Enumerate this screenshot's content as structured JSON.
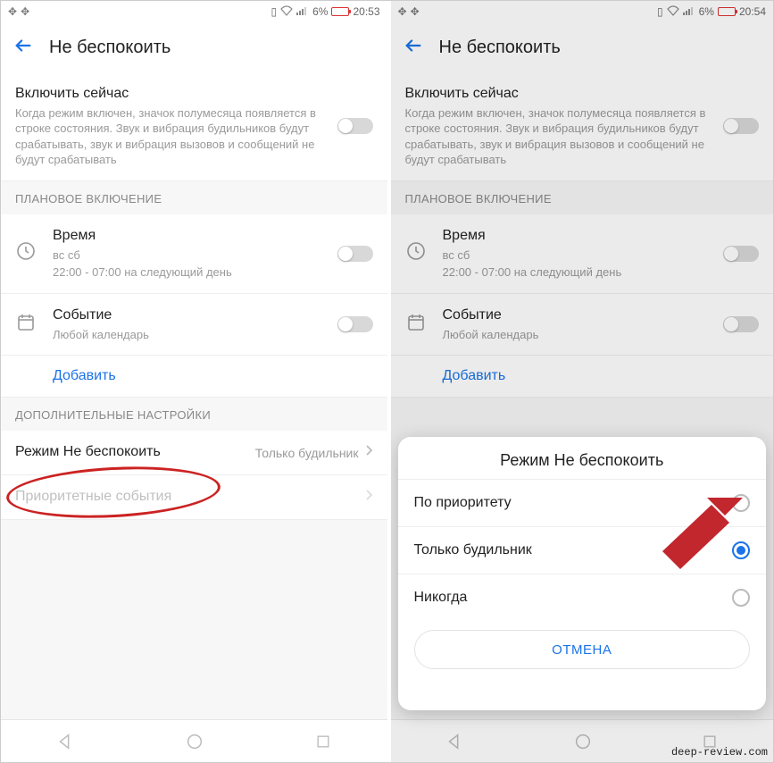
{
  "left": {
    "status": {
      "battery_pct": "6%",
      "time": "20:53"
    },
    "header": {
      "title": "Не беспокоить"
    },
    "enable_now": {
      "title": "Включить сейчас",
      "desc": "Когда режим включен, значок полумесяца появляется в строке состояния. Звук и вибрация будильников будут срабатывать, звук и вибрация вызовов и сообщений не будут срабатывать"
    },
    "sections": {
      "scheduled_header": "ПЛАНОВОЕ ВКЛЮЧЕНИЕ",
      "time_row": {
        "title": "Время",
        "sub1": "вс сб",
        "sub2": "22:00 - 07:00 на следующий день"
      },
      "event_row": {
        "title": "Событие",
        "sub": "Любой календарь"
      },
      "add": "Добавить",
      "extra_header": "ДОПОЛНИТЕЛЬНЫЕ НАСТРОЙКИ",
      "mode_row": {
        "title": "Режим Не беспокоить",
        "value": "Только будильник"
      },
      "priority_row": {
        "title": "Приоритетные события"
      }
    }
  },
  "right": {
    "status": {
      "battery_pct": "6%",
      "time": "20:54"
    },
    "header": {
      "title": "Не беспокоить"
    },
    "enable_now": {
      "title": "Включить сейчас",
      "desc": "Когда режим включен, значок полумесяца появляется в строке состояния. Звук и вибрация будильников будут срабатывать, звук и вибрация вызовов и сообщений не будут срабатывать"
    },
    "sections": {
      "scheduled_header": "ПЛАНОВОЕ ВКЛЮЧЕНИЕ",
      "time_row": {
        "title": "Время",
        "sub1": "вс сб",
        "sub2": "22:00 - 07:00 на следующий день"
      },
      "event_row": {
        "title": "Событие",
        "sub": "Любой календарь"
      },
      "add": "Добавить"
    },
    "dialog": {
      "title": "Режим Не беспокоить",
      "opt1": "По приоритету",
      "opt2": "Только будильник",
      "opt3": "Никогда",
      "cancel": "ОТМЕНА"
    }
  },
  "watermark": "deep-review.com"
}
